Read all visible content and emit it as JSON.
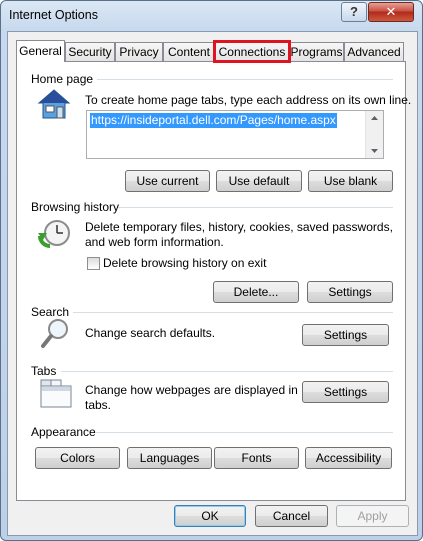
{
  "window": {
    "title": "Internet Options",
    "help_glyph": "?",
    "close_glyph": "✕"
  },
  "tabs": [
    {
      "label": "General",
      "active": true
    },
    {
      "label": "Security"
    },
    {
      "label": "Privacy"
    },
    {
      "label": "Content"
    },
    {
      "label": "Connections",
      "highlighted": true
    },
    {
      "label": "Programs"
    },
    {
      "label": "Advanced"
    }
  ],
  "home_page": {
    "group_title": "Home page",
    "description": "To create home page tabs, type each address on its own line.",
    "url": "https://insideportal.dell.com/Pages/home.aspx",
    "buttons": {
      "use_current": "Use current",
      "use_default": "Use default",
      "use_blank": "Use blank"
    }
  },
  "browsing_history": {
    "group_title": "Browsing history",
    "description_line1": "Delete temporary files, history, cookies, saved passwords,",
    "description_line2": "and web form information.",
    "checkbox_label": "Delete browsing history on exit",
    "checkbox_checked": false,
    "buttons": {
      "delete": "Delete...",
      "settings": "Settings"
    }
  },
  "search": {
    "group_title": "Search",
    "description": "Change search defaults.",
    "settings": "Settings"
  },
  "tabs_group": {
    "group_title": "Tabs",
    "description_line1": "Change how webpages are displayed in",
    "description_line2": "tabs.",
    "settings": "Settings"
  },
  "appearance": {
    "group_title": "Appearance",
    "buttons": {
      "colors": "Colors",
      "languages": "Languages",
      "fonts": "Fonts",
      "accessibility": "Accessibility"
    }
  },
  "footer": {
    "ok": "OK",
    "cancel": "Cancel",
    "apply": "Apply",
    "apply_enabled": false
  },
  "colors": {
    "highlight_border": "#e0141e",
    "selection": "#3399ff"
  }
}
